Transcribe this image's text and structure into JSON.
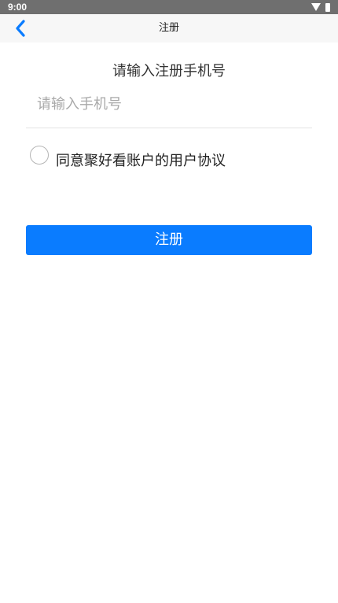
{
  "status_bar": {
    "time": "9:00",
    "icons": [
      "wifi-icon",
      "battery-icon"
    ]
  },
  "nav": {
    "title": "注册",
    "back_icon": "chevron-left-icon",
    "accent_color": "#0a7cff"
  },
  "form": {
    "prompt": "请输入注册手机号",
    "phone_placeholder": "请输入手机号",
    "phone_value": "",
    "agreement_label": "同意聚好看账户的用户协议",
    "agreement_checked": false
  },
  "actions": {
    "register_label": "注册",
    "register_color": "#0a7cff"
  }
}
